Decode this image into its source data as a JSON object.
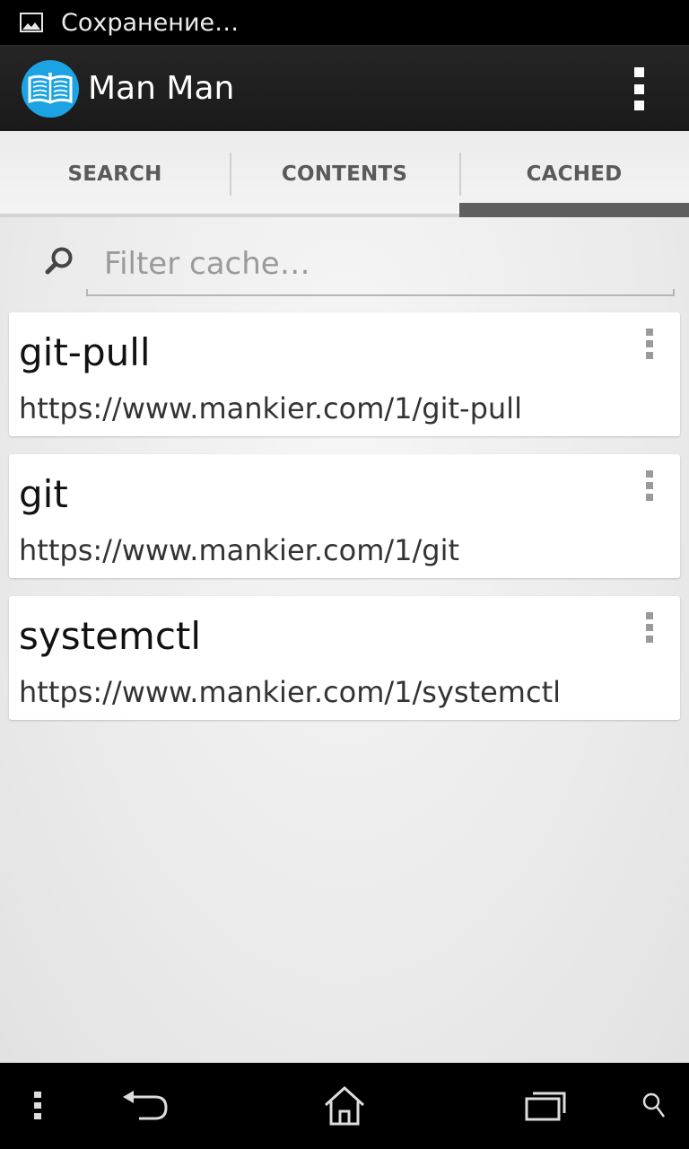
{
  "status_bar": {
    "text": "Сохранение…",
    "icon": "image-icon"
  },
  "action_bar": {
    "title": "Man Man",
    "logo_icon": "book-icon",
    "menu_icon": "overflow-menu-icon"
  },
  "tabs": [
    {
      "label": "SEARCH",
      "selected": false
    },
    {
      "label": "CONTENTS",
      "selected": false
    },
    {
      "label": "CACHED",
      "selected": true
    }
  ],
  "filter": {
    "placeholder": "Filter cache…",
    "value": "",
    "icon": "search-icon"
  },
  "cached_items": [
    {
      "title": "git-pull",
      "url": "https://www.mankier.com/1/git-pull"
    },
    {
      "title": "git",
      "url": "https://www.mankier.com/1/git"
    },
    {
      "title": "systemctl",
      "url": "https://www.mankier.com/1/systemctl"
    }
  ],
  "nav_bar": {
    "buttons": [
      "menu-icon",
      "back-icon",
      "home-icon",
      "recent-apps-icon",
      "search-icon"
    ]
  },
  "colors": {
    "accent": "#1ca3e3",
    "action_bar": "#1f1f1f",
    "tab_indicator": "#5e5e5e"
  }
}
